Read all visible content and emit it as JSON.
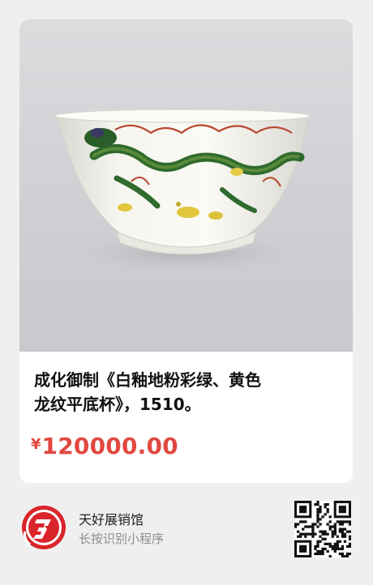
{
  "product": {
    "title": "成化御制《白釉地粉彩绿、黄色\n龙纹平底杯》，1510。",
    "price_currency": "¥",
    "price_amount": "120000.00"
  },
  "mini_program": {
    "store_name": "天好展销馆",
    "hint": "长按识别小程序"
  },
  "colors": {
    "price": "#e0483f",
    "logo_red": "#d9252a",
    "background": "#efefef"
  },
  "icons": [
    "app-logo-icon",
    "qr-code-icon"
  ]
}
